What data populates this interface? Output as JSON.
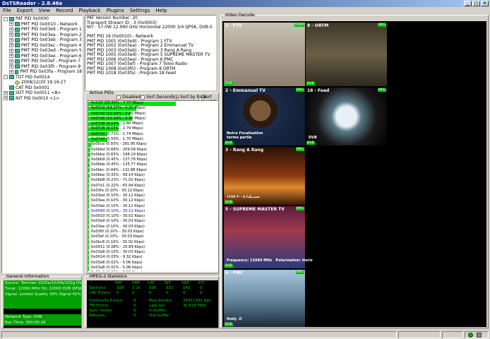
{
  "window": {
    "title": "DsTSReader - 2.8.46e",
    "min_glyph": "_",
    "max_glyph": "□",
    "close_glyph": "×"
  },
  "menu": [
    "File",
    "Export",
    "View",
    "Record",
    "Playback",
    "Plugins",
    "Settings",
    "Help"
  ],
  "tree": [
    {
      "label": "PAT PID 0x0000",
      "indent": 0,
      "exp": "-",
      "icon": "table"
    },
    {
      "label": "PMT PID 0x0010 - Network",
      "indent": 1,
      "exp": "+",
      "icon": "table"
    },
    {
      "label": "PMT PID 0x03e9 - Program 1",
      "indent": 1,
      "exp": "+",
      "icon": "table"
    },
    {
      "label": "PMT PID 0x03ea - Program 2",
      "indent": 1,
      "exp": "+",
      "icon": "table"
    },
    {
      "label": "PMT PID 0x03eb - Program 3",
      "indent": 1,
      "exp": "+",
      "icon": "table"
    },
    {
      "label": "PMT PID 0x03ec - Program 4",
      "indent": 1,
      "exp": "+",
      "icon": "table"
    },
    {
      "label": "PMT PID 0x03ed - Program 5",
      "indent": 1,
      "exp": "+",
      "icon": "table"
    },
    {
      "label": "PMT PID 0x03ee - Program 6",
      "indent": 1,
      "exp": "+",
      "icon": "table"
    },
    {
      "label": "PMT PID 0x03ef - Program 7",
      "indent": 1,
      "exp": "+",
      "icon": "table"
    },
    {
      "label": "PMT PID 0x03f0 - Program 8",
      "indent": 1,
      "exp": "+",
      "icon": "table"
    },
    {
      "label": "PMT PID 0x03fa - Program 18",
      "indent": 1,
      "exp": "+",
      "icon": "table"
    },
    {
      "label": "TDT PID 0x0014",
      "indent": 0,
      "exp": "-",
      "icon": "table"
    },
    {
      "label": "2008/12/20 19:16:27",
      "indent": 1,
      "exp": "",
      "icon": "clock"
    },
    {
      "label": "CAT PID 0x0001",
      "indent": 0,
      "exp": "",
      "icon": "table"
    },
    {
      "label": "SDT PID 0x0011 <8>",
      "indent": 0,
      "exp": "+",
      "icon": "table"
    },
    {
      "label": "NIT PID 0x0010 <1>",
      "indent": 0,
      "exp": "+",
      "icon": "table"
    }
  ],
  "info_lines": [
    "PAT Version Number: 20",
    "Transport Stream ID : 3 (0x0003)",
    "NIT : 57.0W 12.060 GHz Horizontal 22000 3/4 QPSK, DVB-S",
    "",
    "PMT PID 16 (0x0010) - Network",
    "PMT PID 1001 (0x03e9) - Program 1 FTV",
    "PMT PID 1002 (0x03ea) - Program 2 Emmanuel TV",
    "PMT PID 1003 (0x03eb) - Program 3 Rang A Rang",
    "PMT PID 1005 (0x03ed) - Program 5 SUPREME MASTER TV",
    "PMT PID 1006 (0x03ee) - Program 6 PMC",
    "PMT PID 1007 (0x03ef) - Program 7 Toloo Radio",
    "PMT PID 1008 (0x03f0) - Program 8 ORTM",
    "PMT PID 1018 (0x03fa) - Program 18 Feed"
  ],
  "active_pids": {
    "title": "Active PIDs",
    "options": {
      "disabled": "Disabled",
      "sort_desc": "Sort Decending",
      "sort_rate": "Sort by Rate",
      "sort_pid": "Sort by PID"
    },
    "rows": [
      {
        "label": "0x11ff (25.64% - 7.77 Mbps)",
        "pct": 0.26
      },
      {
        "label": "0x07d2 (14.17% - 4.31 Mbps)",
        "pct": 0.142
      },
      {
        "label": "0x07d0 (12.50% - 3.80 Mbps)",
        "pct": 0.125
      },
      {
        "label": "0x07d6 (13.14% - 3.99 Mbps)",
        "pct": 0.131
      },
      {
        "label": "0x07d8 (9.19% - 2.80 Mbps)",
        "pct": 0.092
      },
      {
        "label": "0x07d8 (9.15% - 2.79 Mbps)",
        "pct": 0.091
      },
      {
        "label": "0x07d2 (5.71% - 1.74 Mbps)",
        "pct": 0.057
      },
      {
        "label": "0x07d0 (5.59% - 1.70 Mbps)",
        "pct": 0.056
      },
      {
        "label": "0x0bca (0.93% - 281.95 Kbps)",
        "pct": 0.009
      },
      {
        "label": "0x0bbd (0.68% - 209.09 Kbps)",
        "pct": 0.007
      },
      {
        "label": "0x0bba (0.65% - 198.19 Kbps)",
        "pct": 0.006
      },
      {
        "label": "0x0bb9 (0.45% - 137.76 Kbps)",
        "pct": 0.0045
      },
      {
        "label": "0x0bbb (0.45% - 135.77 Kbps)",
        "pct": 0.0045
      },
      {
        "label": "0x0bbc (0.44% - 132.88 Kbps)",
        "pct": 0.0044
      },
      {
        "label": "0x0bbe (0.33% - 99.14 Kbps)",
        "pct": 0.0033
      },
      {
        "label": "0x0bb8 (0.23% - 71.02 Kbps)",
        "pct": 0.0023
      },
      {
        "label": "0x07e1 (0.22% - 65.94 Kbps)",
        "pct": 0.0022
      },
      {
        "label": "0x03fa (0.10% - 30.12 Kbps)",
        "pct": 0.001
      },
      {
        "label": "0x03ed (0.10% - 30.12 Kbps)",
        "pct": 0.001
      },
      {
        "label": "0x03ea (0.10% - 30.12 Kbps)",
        "pct": 0.001
      },
      {
        "label": "0x03eb (0.10% - 30.12 Kbps)",
        "pct": 0.001
      },
      {
        "label": "0x0000 (0.10% - 30.12 Kbps)",
        "pct": 0.001,
        "selected": true
      },
      {
        "label": "0x0010 (0.10% - 30.02 Kbps)",
        "pct": 0.001
      },
      {
        "label": "0x03e9 (0.10% - 30.03 Kbps)",
        "pct": 0.001
      },
      {
        "label": "0x03ee (0.10% - 30.03 Kbps)",
        "pct": 0.001
      },
      {
        "label": "0x03f0 (0.10% - 30.03 Kbps)",
        "pct": 0.001
      },
      {
        "label": "0x03ef (0.10% - 30.03 Kbps)",
        "pct": 0.001
      },
      {
        "label": "0x0bc8 (0.10% - 30.02 Kbps)",
        "pct": 0.001
      },
      {
        "label": "0x0011 (0.08% - 25.89 Kbps)",
        "pct": 0.0008
      },
      {
        "label": "0x03e8 (0.10% - 30.03 Kbps)",
        "pct": 0.001
      },
      {
        "label": "0x0014 (0.03% - 9.32 Kbps)",
        "pct": 0.0003
      },
      {
        "label": "0x03e8 (0.02% - 5.06 Kbps)",
        "pct": 0.0002
      },
      {
        "label": "0x03a8 (0.02% - 5.06 Kbps)",
        "pct": 0.0002
      },
      {
        "label": "0x03e9 (0.02% - 5.06 Kbps)",
        "pct": 0.0002
      }
    ]
  },
  "video": {
    "title": "Video Decode",
    "tiles": [
      {
        "label": "1 - FTV",
        "tags": [
          "H264",
          "DVB"
        ],
        "bg": "fashion"
      },
      {
        "label": "8 - ORTM",
        "tags": [
          "MPG",
          "DVB"
        ],
        "bg": "crowd"
      },
      {
        "label": "2 - Emmanuel TV",
        "tags": [
          "MPG",
          "DVB"
        ],
        "bg": "preacher",
        "caption": "Notre Focalisation\nterme partie"
      },
      {
        "label": "18 - Feed",
        "tags": [
          "MPG",
          "DVB"
        ],
        "bg": "feed",
        "caption": "DVB"
      },
      {
        "label": "3 - Rang A Rang",
        "tags": [
          "MPG",
          "DVB"
        ],
        "bg": "fire",
        "caption": "شب‌یلدا ۲۰۰۸ ۱۳۸۷"
      },
      {
        "label": "5 - SUPREME MASTER TV",
        "tags": [
          "MPG",
          "DVB"
        ],
        "bg": "supreme",
        "caption": "Frequency: 12060 MHz   Polarization: Horiz"
      },
      {
        "label": "6 - PMC",
        "tags": [
          "MPG",
          "DVB"
        ],
        "bg": "pmc",
        "caption": "Andy .ll"
      }
    ]
  },
  "general": {
    "title": "General Information",
    "rows": [
      {
        "text": "Source: Twinhan 1020a/1020b/102g DVB-S",
        "green": true
      },
      {
        "text": "Tuner: 12060 MHz H/L 22000 DVB QPSK",
        "green": true
      },
      {
        "text": "Signal: Locked Quality 39% Signal 42%",
        "green": true
      },
      {
        "text": "",
        "green": true
      },
      {
        "text": "",
        "green": true
      },
      {
        "text": "",
        "green": false
      },
      {
        "text": "Network Type: DVB",
        "green": true
      },
      {
        "text": "Run Time: 000:00:16",
        "green": true
      }
    ]
  },
  "stats": {
    "title": "MPEG-2 Statistics",
    "headers": [
      "PAT",
      "PMT",
      "CAT",
      "NIT",
      "SDT",
      "EIT"
    ],
    "sections_label": "Sections",
    "sections": [
      "328",
      "2.1k",
      "336",
      "332",
      "143",
      "0"
    ],
    "crc_label": "CRC Errors",
    "crc": [
      "0",
      "0",
      "0",
      "0",
      "0",
      "0"
    ],
    "continuity_label": "Continuity Errors:",
    "continuity_val": "0",
    "mux_label": "Mux bitrate:",
    "mux_val": "30411792 bps",
    "tei_label": "TEI Errors:",
    "tei_val": "0",
    "lastsec_label": "Last sec:",
    "lastsec_val": "30.618 Mbit",
    "sync_label": "Sync losses:",
    "sync_val": "0",
    "inbuf_label": "In buffer:",
    "inbuf_val": "",
    "retunes_label": "Retunes:",
    "retunes_val": "0",
    "outbuf_label": "Out buffer:",
    "outbuf_val": ""
  },
  "colors": {
    "bar": "#00e400",
    "stats_text": "#00d000",
    "tag": "#00c000"
  }
}
